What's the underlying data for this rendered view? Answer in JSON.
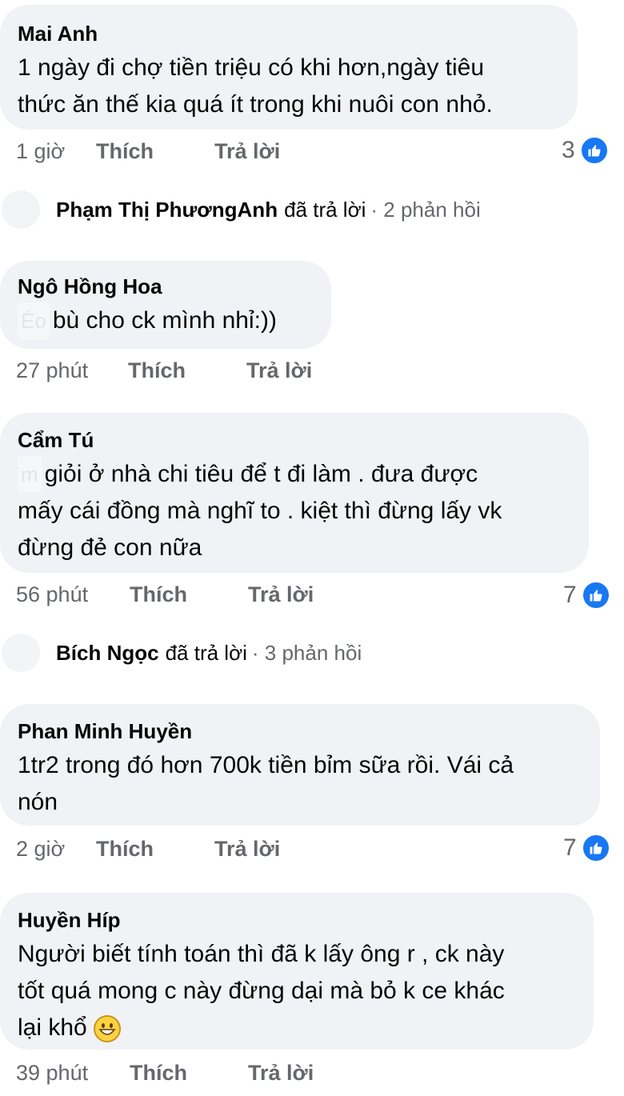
{
  "comments": [
    {
      "author": "Mai Anh",
      "lines": [
        "1 ngày đi chợ tiền triệu có khi hơn,ngày tiêu",
        "thức ăn thế kia quá ít trong khi nuôi con nhỏ."
      ],
      "time": "1 giờ",
      "like_label": "Thích",
      "reply_label": "Trả lời",
      "reactions": "3"
    },
    {
      "author": "Ngô Hồng Hoa",
      "blur": "Éo",
      "lines": [
        "bù cho ck mình nhỉ:))"
      ],
      "time": "27 phút",
      "like_label": "Thích",
      "reply_label": "Trả lời"
    },
    {
      "author": "Cẩm Tú",
      "blur": "m",
      "lines": [
        "giỏi ở nhà chi tiêu để t đi làm . đưa được",
        "mấy cái đồng mà nghĩ to . kiệt thì đừng lấy vk",
        "đừng đẻ con nữa"
      ],
      "time": "56 phút",
      "like_label": "Thích",
      "reply_label": "Trả lời",
      "reactions": "7"
    },
    {
      "author": "Phan Minh Huyền",
      "lines": [
        "1tr2 trong đó hơn 700k tiền bỉm sữa rồi. Vái cả",
        "nón"
      ],
      "time": "2 giờ",
      "like_label": "Thích",
      "reply_label": "Trả lời",
      "reactions": "7"
    },
    {
      "author": "Huyền Híp",
      "lines": [
        "Người biết tính toán thì đã k lấy ông r , ck này",
        "tốt quá mong c này đừng dại mà bỏ k ce khác",
        "lại khổ"
      ],
      "time": "39 phút",
      "like_label": "Thích",
      "reply_label": "Trả lời"
    }
  ],
  "replies": [
    {
      "name": "Phạm Thị PhươngAnh",
      "action": "đã trả lời",
      "count": "· 2 phản hồi"
    },
    {
      "name": "Bích Ngọc",
      "action": "đã trả lời",
      "count": "· 3 phản hồi"
    }
  ],
  "colors": {
    "like_blue": "#1877f2",
    "bubble": "#f0f2f5",
    "meta": "#65676b"
  }
}
